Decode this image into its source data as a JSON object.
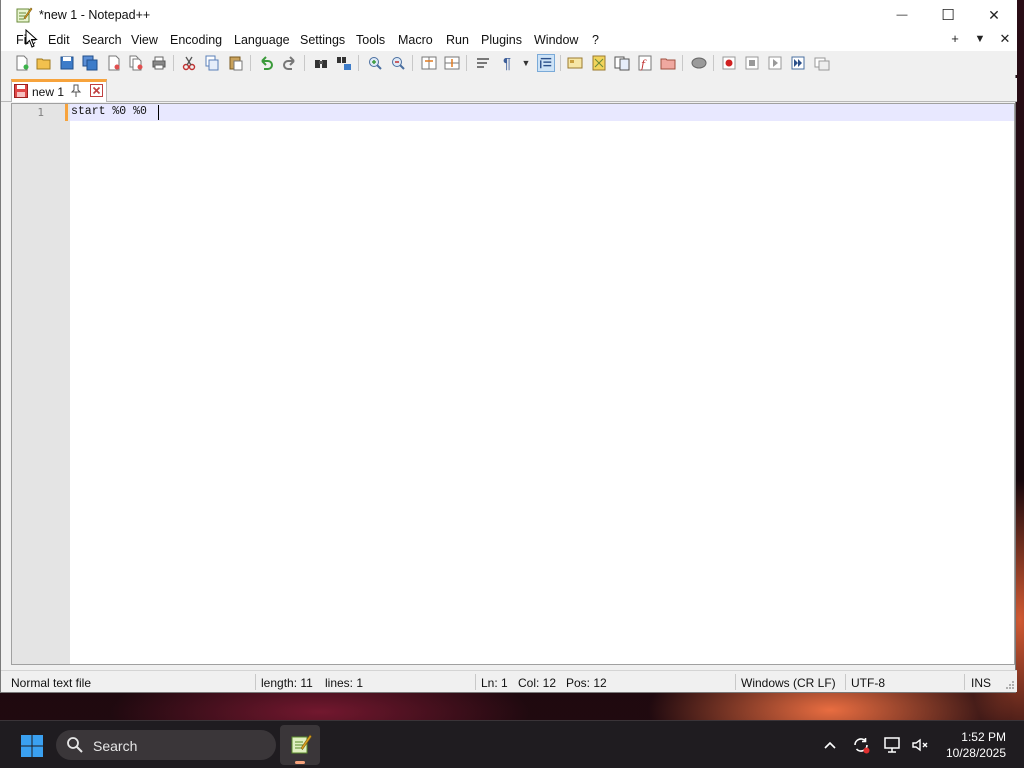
{
  "window": {
    "title": "*new 1 - Notepad++",
    "minimize_glyph": "—",
    "maximize_glyph": "☐",
    "close_glyph": "✕"
  },
  "menu": {
    "items": [
      "File",
      "Edit",
      "Search",
      "View",
      "Encoding",
      "Language",
      "Settings",
      "Tools",
      "Macro",
      "Run",
      "Plugins",
      "Window",
      "?"
    ],
    "right": {
      "add": "+",
      "list": "▼",
      "close": "✕"
    }
  },
  "toolbar": {
    "icons": [
      "new-file-icon",
      "open-file-icon",
      "save-icon",
      "save-all-icon",
      "close-icon",
      "close-all-icon",
      "print-icon",
      "cut-icon",
      "copy-icon",
      "paste-icon",
      "undo-icon",
      "redo-icon",
      "find-icon",
      "replace-icon",
      "zoom-in-icon",
      "zoom-out-icon",
      "sync-vertical-icon",
      "sync-horizontal-icon",
      "word-wrap-icon",
      "show-all-chars-icon",
      "indent-guide-icon",
      "user-language-icon",
      "doc-map-icon",
      "function-list-icon",
      "folder-workspace-icon",
      "doc-list-icon",
      "monitoring-icon",
      "record-macro-icon",
      "stop-macro-icon",
      "play-macro-icon",
      "run-macro-multiple-icon",
      "save-macro-icon"
    ]
  },
  "tabs": [
    {
      "label": "new 1",
      "modified": true
    }
  ],
  "editor": {
    "lines": [
      {
        "number": "1",
        "text": "start %0 %0"
      }
    ]
  },
  "status": {
    "file_type": "Normal text file",
    "length": "length: 11",
    "lines": "lines: 1",
    "ln": "Ln: 1",
    "col": "Col: 12",
    "pos": "Pos: 12",
    "eol": "Windows (CR LF)",
    "encoding": "UTF-8",
    "mode": "INS"
  },
  "taskbar": {
    "search_label": "Search",
    "time": "1:52 PM",
    "date": "10/28/2025"
  },
  "colors": {
    "tab_accent": "#f7a33c",
    "current_line": "#e8e8ff",
    "taskbar": "#1f1c20"
  }
}
